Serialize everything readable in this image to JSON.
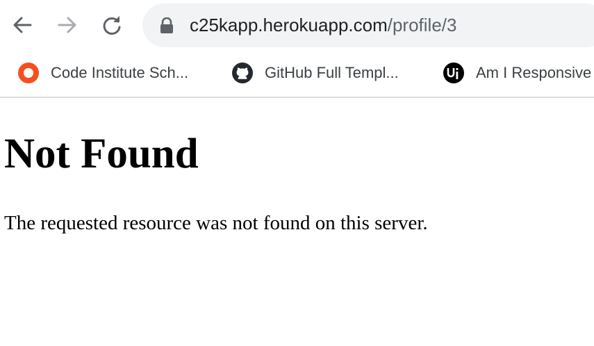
{
  "browser": {
    "address_bar": {
      "host": "c25kapp.herokuapp.com",
      "path": "/profile/3"
    },
    "nav_icons": {
      "back": "arrow-left-icon",
      "forward": "arrow-right-icon",
      "reload": "reload-icon",
      "lock": "lock-icon"
    },
    "bookmarks": [
      {
        "label": "Code Institute Sch...",
        "icon": "code-institute-icon",
        "color": "#f4511e"
      },
      {
        "label": "GitHub Full Templ...",
        "icon": "github-icon",
        "color": "#000000"
      },
      {
        "label": "Am I Responsive",
        "icon": "ui-icon",
        "color": "#000000"
      }
    ]
  },
  "page": {
    "heading": "Not Found",
    "message": "The requested resource was not found on this server."
  }
}
